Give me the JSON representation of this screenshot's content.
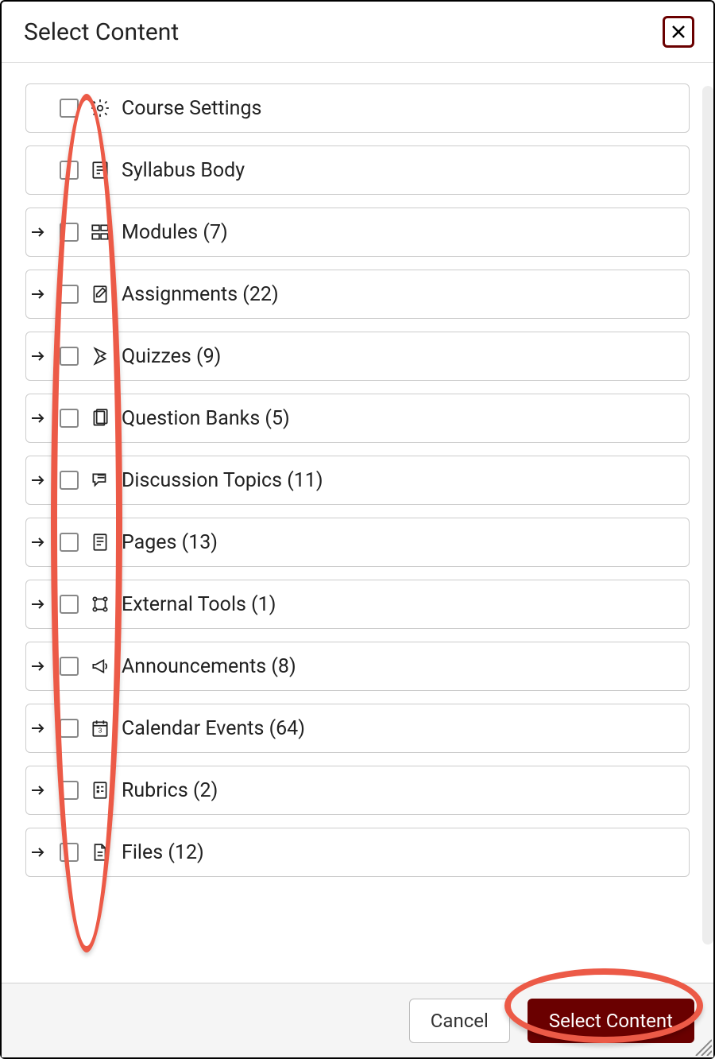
{
  "dialog": {
    "title": "Select Content",
    "cancel_label": "Cancel",
    "submit_label": "Select Content"
  },
  "items": [
    {
      "label": "Course Settings",
      "expandable": false,
      "icon": "gear"
    },
    {
      "label": "Syllabus Body",
      "expandable": false,
      "icon": "syllabus"
    },
    {
      "label": "Modules (7)",
      "expandable": true,
      "icon": "modules"
    },
    {
      "label": "Assignments (22)",
      "expandable": true,
      "icon": "assignment"
    },
    {
      "label": "Quizzes (9)",
      "expandable": true,
      "icon": "quiz"
    },
    {
      "label": "Question Banks (5)",
      "expandable": true,
      "icon": "questionbank"
    },
    {
      "label": "Discussion Topics (11)",
      "expandable": true,
      "icon": "discussion"
    },
    {
      "label": "Pages (13)",
      "expandable": true,
      "icon": "page"
    },
    {
      "label": "External Tools (1)",
      "expandable": true,
      "icon": "external"
    },
    {
      "label": "Announcements (8)",
      "expandable": true,
      "icon": "announcement"
    },
    {
      "label": "Calendar Events (64)",
      "expandable": true,
      "icon": "calendar"
    },
    {
      "label": "Rubrics (2)",
      "expandable": true,
      "icon": "rubric"
    },
    {
      "label": "Files (12)",
      "expandable": true,
      "icon": "file"
    }
  ]
}
